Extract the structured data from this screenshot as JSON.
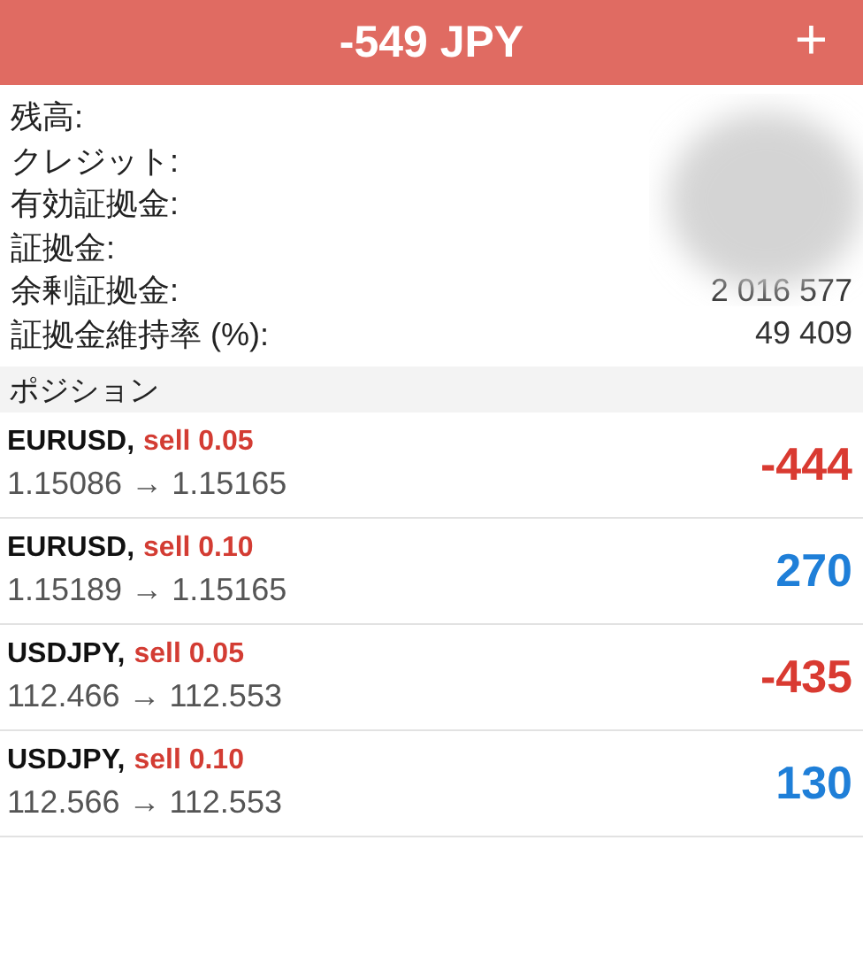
{
  "header": {
    "title": "-549 JPY",
    "action": "+"
  },
  "summary": [
    {
      "label": "残高:"
    },
    {
      "label": "クレジット:"
    },
    {
      "label": "有効証拠金:"
    },
    {
      "label": "証拠金:"
    },
    {
      "label": "余剰証拠金:",
      "value": "2 016 577"
    },
    {
      "label": "証拠金維持率 (%):",
      "value": "49 409"
    }
  ],
  "positions_header": "ポジション",
  "positions": [
    {
      "symbol": "EURUSD,",
      "order": "sell 0.05",
      "prices": "1.15086 → 1.15165",
      "profit": "-444",
      "color": "#d93a31"
    },
    {
      "symbol": "EURUSD,",
      "order": "sell 0.10",
      "prices": "1.15189 → 1.15165",
      "profit": "270",
      "color": "#1f7fd8"
    },
    {
      "symbol": "USDJPY,",
      "order": "sell 0.05",
      "prices": "112.466 → 112.553",
      "profit": "-435",
      "color": "#d93a31"
    },
    {
      "symbol": "USDJPY,",
      "order": "sell 0.10",
      "prices": "112.566 → 112.553",
      "profit": "130",
      "color": "#1f7fd8"
    }
  ]
}
